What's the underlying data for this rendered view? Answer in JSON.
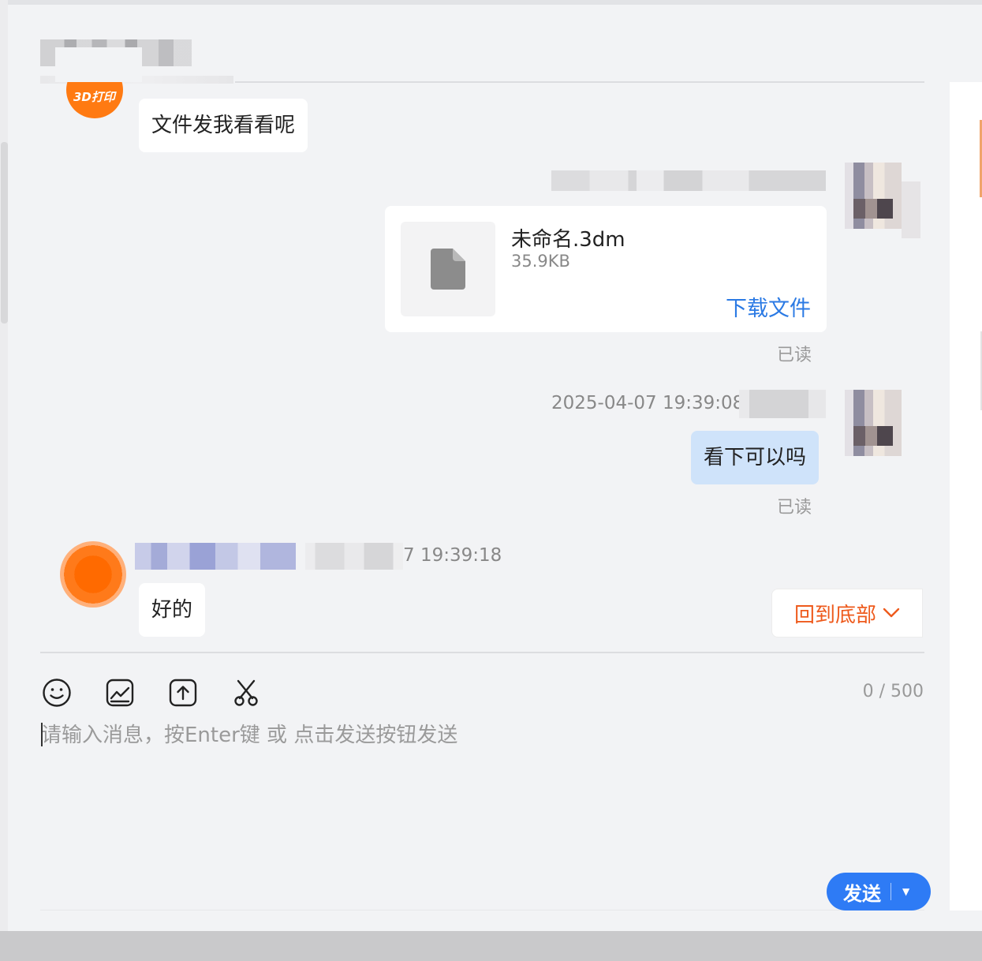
{
  "colors": {
    "accent_blue": "#2e7bf5",
    "link_blue": "#2b7ae4",
    "bubble_blue": "#cfe3fa",
    "back_bottom_orange": "#ee5a1c",
    "avatar_orange": "#ff6a00"
  },
  "messages": {
    "m1": {
      "text": "文件发我看看呢"
    },
    "m2": {
      "file_name": "未命名.3dm",
      "file_size": "35.9KB",
      "download_label": "下载文件",
      "file_icon": "file-icon",
      "read_status": "已读"
    },
    "m3": {
      "timestamp": "2025-04-07 19:39:08",
      "text": "看下可以吗",
      "read_status": "已读"
    },
    "m4": {
      "timestamp_partial": "7 19:39:18",
      "text": "好的"
    }
  },
  "back_to_bottom": {
    "label": "回到底部",
    "icon": "chevron-down-icon"
  },
  "toolbar": {
    "icons": [
      "emoji-icon",
      "image-icon",
      "upload-icon",
      "scissors-icon"
    ],
    "counter": "0 / 500"
  },
  "input": {
    "placeholder": "请输入消息，按Enter键 或 点击发送按钮发送"
  },
  "send": {
    "label": "发送",
    "dropdown_icon": "caret-down-icon"
  }
}
